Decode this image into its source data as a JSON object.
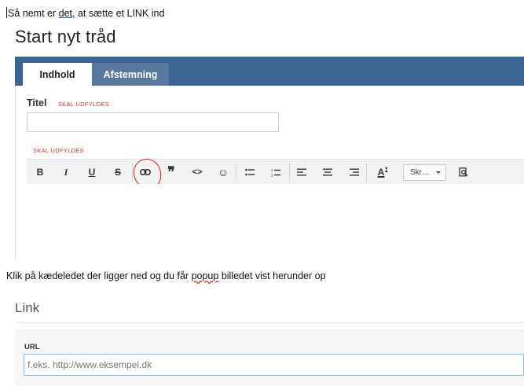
{
  "doc": {
    "line1": {
      "part1": "Så nemt er ",
      "part2": "det,",
      "part3": " at sætte et LINK ind"
    },
    "line2": {
      "part1": "Klik på kædeledet der ligger ned og du får ",
      "part2": "popup",
      "part3": " billedet vist herunder op"
    }
  },
  "form": {
    "page_title": "Start nyt tråd",
    "tabs": [
      {
        "label": "Indhold",
        "active": true
      },
      {
        "label": "Afstemning",
        "active": false
      }
    ],
    "title_label": "Titel",
    "required_label": "SKAL UDFYLDES",
    "required_label_2": "SKAL UDFYLDES"
  },
  "toolbar": {
    "bold": "B",
    "italic": "I",
    "underline": "U",
    "strike": "S",
    "quote": "❞",
    "code": "<>",
    "emoji": "☺",
    "align_left": "≡",
    "font_color": "A",
    "format_select": "Skr…",
    "icons": [
      "bold-icon",
      "italic-icon",
      "underline-icon",
      "strikethrough-icon",
      "link-icon",
      "quote-icon",
      "code-icon",
      "emoji-icon",
      "bullet-list-icon",
      "numbered-list-icon",
      "align-left-icon",
      "align-center-icon",
      "align-right-icon",
      "font-color-icon",
      "format-select",
      "preview-icon"
    ]
  },
  "link_dialog": {
    "title": "Link",
    "url_label": "URL",
    "url_placeholder": "f.eks. http://www.eksempel.dk",
    "url_value": ""
  },
  "colors": {
    "tabbar": "#3d6592",
    "tab_inactive": "#58789e",
    "required": "#c0392b",
    "annotation_circle": "#e01b1b",
    "input_focus": "#8fb8e0"
  }
}
